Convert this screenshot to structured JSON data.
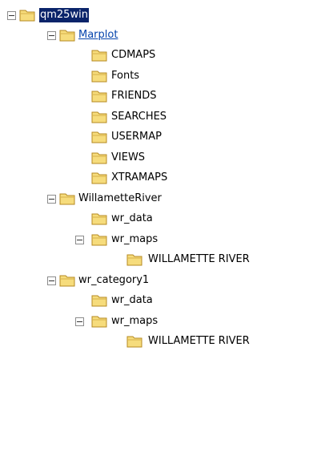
{
  "tree": {
    "root": {
      "label": "qm25win",
      "selected": true,
      "expanded": true,
      "children": [
        {
          "label": "Marplot",
          "link": true,
          "expanded": true,
          "children": [
            {
              "label": "CDMAPS"
            },
            {
              "label": "Fonts"
            },
            {
              "label": "FRIENDS"
            },
            {
              "label": "SEARCHES"
            },
            {
              "label": "USERMAP"
            },
            {
              "label": "VIEWS"
            },
            {
              "label": "XTRAMAPS"
            }
          ]
        },
        {
          "label": "WillametteRiver",
          "expanded": true,
          "children": [
            {
              "label": "wr_data"
            },
            {
              "label": "wr_maps",
              "expanded": true,
              "children": [
                {
                  "label": "WILLAMETTE RIVER"
                }
              ]
            }
          ]
        },
        {
          "label": "wr_category1",
          "expanded": true,
          "children": [
            {
              "label": "wr_data"
            },
            {
              "label": "wr_maps",
              "expanded": true,
              "children": [
                {
                  "label": "WILLAMETTE RIVER"
                }
              ]
            }
          ]
        }
      ]
    }
  },
  "colors": {
    "folder_fill": "#f6dc7c",
    "folder_stroke": "#b58a22",
    "selection_bg": "#0a246a",
    "link": "#0645ad",
    "toggle_border": "#8c8c8c"
  },
  "icons": {
    "folder": "folder-icon",
    "collapse": "minus-box-icon"
  }
}
